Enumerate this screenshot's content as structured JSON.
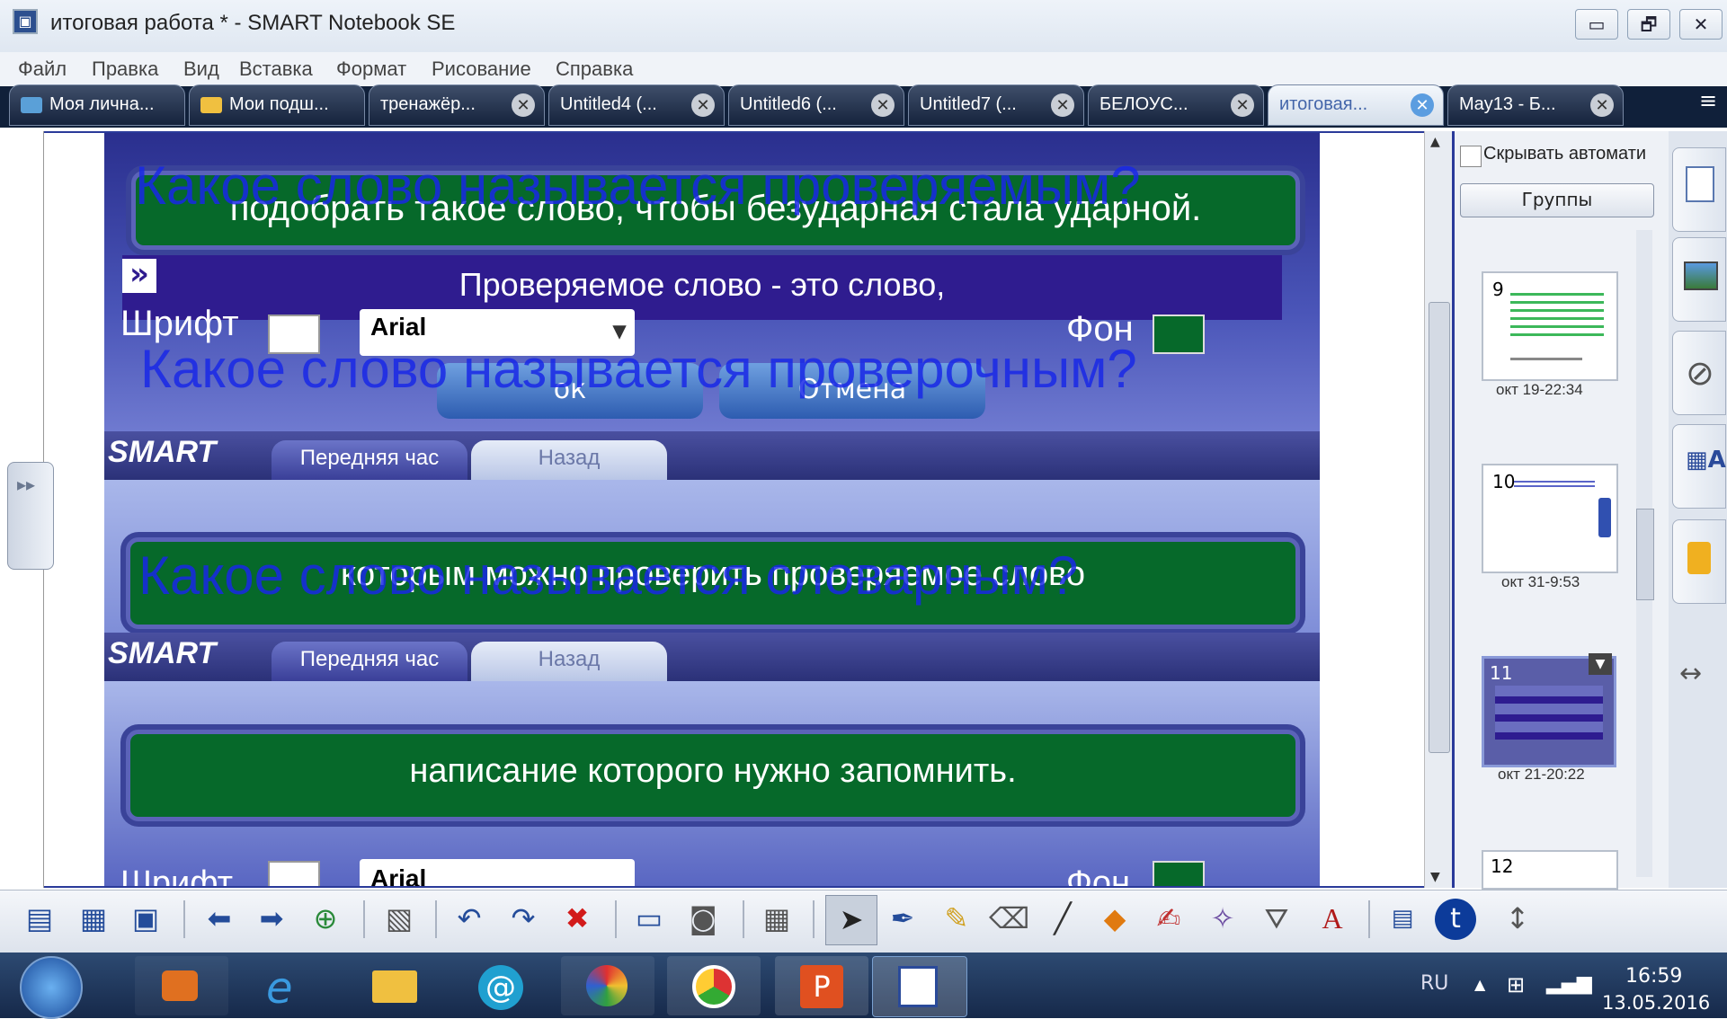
{
  "window": {
    "title": "итоговая работа * - SMART Notebook SE",
    "app_icon": "notebook-app-icon",
    "controls": [
      "▭",
      "🗗",
      "✕"
    ]
  },
  "menu": [
    "Файл",
    "Правка",
    "Вид",
    "Вставка",
    "Формат",
    "Рисование",
    "Справка"
  ],
  "tabs": [
    {
      "label": "Моя лична...",
      "icon": "home-icon",
      "closable": false
    },
    {
      "label": "Мои подш...",
      "icon": "folder-icon",
      "closable": false
    },
    {
      "label": "тренажёр...",
      "closable": true
    },
    {
      "label": "Untitled4 (...",
      "closable": true
    },
    {
      "label": "Untitled6 (...",
      "closable": true
    },
    {
      "label": "Untitled7 (...",
      "closable": true
    },
    {
      "label": "БЕЛОУС...",
      "closable": true
    },
    {
      "label": "итоговая...",
      "closable": true,
      "active": true
    },
    {
      "label": "May13 - Б...",
      "closable": true
    }
  ],
  "canvas": {
    "questions": [
      "Какое слово называется проверяемым?",
      "Какое слово называется проверочным?",
      "Какое слово называется словарным?"
    ],
    "answer1": "подобрать такое слово, чтобы безударная стала ударной.",
    "popup_text": "Проверяемое слово - это слово,",
    "popup_arrow": "»",
    "font_label": "Шрифт",
    "font_value": "Arial",
    "bg_label": "Фон",
    "ok": "ок",
    "cancel": "Отмена",
    "smart_logo": "SMART",
    "tab_front": "Передняя час",
    "tab_back": "Назад",
    "answer2": "которым можно проверить проверяемое слово",
    "answer3": "написание которого нужно запомнить.",
    "font_label2": "Шрифт",
    "font_value2": "Arial",
    "bg_label2": "Фон"
  },
  "sorter": {
    "autohide_label": "Скрывать автомати",
    "groups_button": "Группы",
    "pages": [
      {
        "num": "9",
        "label": "окт 19-22:34"
      },
      {
        "num": "10",
        "label": "окт 31-9:53"
      },
      {
        "num": "11",
        "label": "окт 21-20:22"
      },
      {
        "num": "12",
        "label": ""
      }
    ]
  },
  "taskbar": {
    "lang": "RU",
    "time": "16:59",
    "date": "13.05.2016"
  },
  "colors": {
    "panel_blue": "#3a4399",
    "answer_green": "#06692a",
    "question_blue": "#1928e6"
  }
}
